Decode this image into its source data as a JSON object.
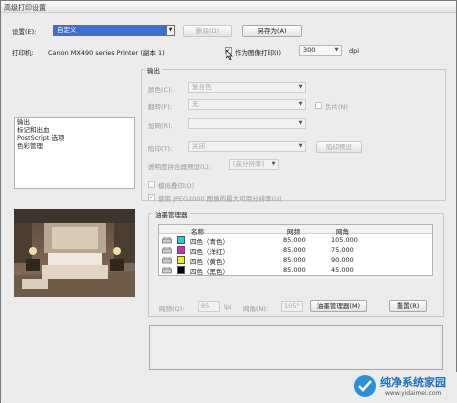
{
  "window": {
    "title": "高级打印设置"
  },
  "top": {
    "settings_label": "设置(E):",
    "settings_value": "自定义",
    "delete_button": "删除(D)",
    "save_as_button": "另存为(A)",
    "printer_label": "打印机:",
    "printer_name": "Canon MX490 series Printer (副本 1)",
    "print_as_image_label": "作为图像打印(I)",
    "print_as_image_checked": true,
    "dpi_value": "300",
    "dpi_unit": "dpi"
  },
  "sidebar": {
    "items": [
      {
        "label": "输出"
      },
      {
        "label": "标记和出血"
      },
      {
        "label": "PostScript 选项"
      },
      {
        "label": "色彩管理"
      }
    ]
  },
  "output": {
    "group_title": "输出",
    "color_label": "颜色(C):",
    "color_value": "复合色",
    "flip_label": "翻转(F):",
    "flip_value": "无",
    "negative_label": "负片(N)",
    "screening_label": "加网(R):",
    "screening_value": "",
    "trapping_label": "陷印(T):",
    "trapping_value": "关闭",
    "trap_presets_button": "陷印预设",
    "transparency_label": "透明度拼合器预设(L):",
    "transparency_value": "[高分辨率]",
    "simulate_overprint_label": "模拟叠印(O)",
    "jpeg2000_label": "使用 JPEG2000 图像的最大可用分辨率(U)",
    "jpeg2000_checked": true
  },
  "ink_manager": {
    "group_title": "油墨管理器",
    "columns": [
      "名称",
      "网频",
      "网角"
    ],
    "rows": [
      {
        "name": "四色（青色）",
        "frequency": "85.000",
        "angle": "105.000",
        "color": "#19d3e8"
      },
      {
        "name": "四色（洋红）",
        "frequency": "85.000",
        "angle": "75.000",
        "color": "#d42bbf"
      },
      {
        "name": "四色（黄色）",
        "frequency": "85.000",
        "angle": "90.000",
        "color": "#f2ee14"
      },
      {
        "name": "四色（黑色）",
        "frequency": "85.000",
        "angle": "45.000",
        "color": "#000000"
      }
    ],
    "frequency_label": "网频(Q):",
    "frequency_value": "85",
    "frequency_unit": "lpi",
    "angle_label": "网角(N):",
    "angle_value": "105°",
    "ink_manager_button": "油墨管理器(M)",
    "reset_button": "重置(R)"
  },
  "watermark": {
    "brand": "纯净系统家园",
    "url": "www.yidaimei.com"
  }
}
